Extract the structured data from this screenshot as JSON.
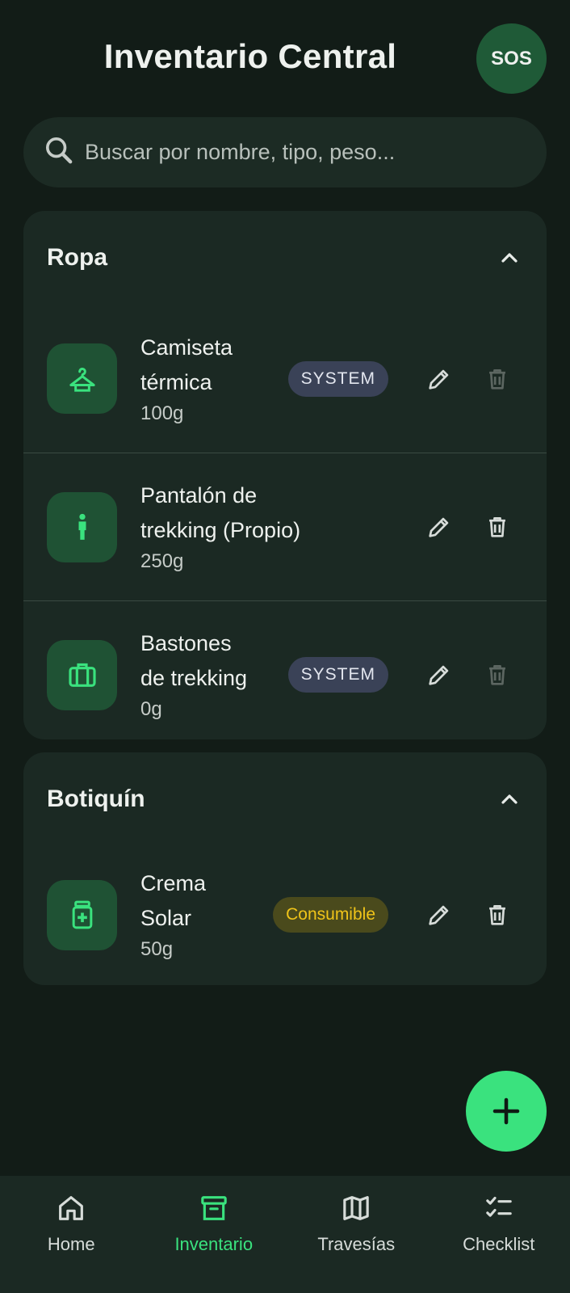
{
  "header": {
    "title": "Inventario Central",
    "sos_label": "SOS"
  },
  "search": {
    "placeholder": "Buscar por nombre, tipo, peso..."
  },
  "categories": [
    {
      "title": "Ropa",
      "items": [
        {
          "name_line1": "Camiseta",
          "name_line2": "térmica",
          "weight": "100g",
          "badge": "SYSTEM",
          "icon": "hanger-icon"
        },
        {
          "name_line1": "Pantalón de",
          "name_line2": "trekking (Propio)",
          "weight": "250g",
          "badge": "",
          "icon": "person-icon"
        },
        {
          "name_line1": "Bastones",
          "name_line2": "de trekking",
          "weight": "0g",
          "badge": "SYSTEM",
          "icon": "luggage-icon"
        }
      ]
    },
    {
      "title": "Botiquín",
      "items": [
        {
          "name_line1": "Crema",
          "name_line2": "Solar",
          "weight": "50g",
          "badge": "Consumible",
          "icon": "medication-icon"
        }
      ]
    }
  ],
  "nav": {
    "items": [
      {
        "label": "Home",
        "icon": "home-icon"
      },
      {
        "label": "Inventario",
        "icon": "archive-icon",
        "active": true
      },
      {
        "label": "Travesías",
        "icon": "map-icon"
      },
      {
        "label": "Checklist",
        "icon": "checklist-icon"
      }
    ]
  },
  "colors": {
    "background": "#121c17",
    "card": "#1b2923",
    "accent": "#3ae27e",
    "icon_bg": "#1f5234",
    "system_badge": "#3a4257",
    "consumible_badge": "#4a4a1c",
    "consumible_text": "#f0c419"
  }
}
